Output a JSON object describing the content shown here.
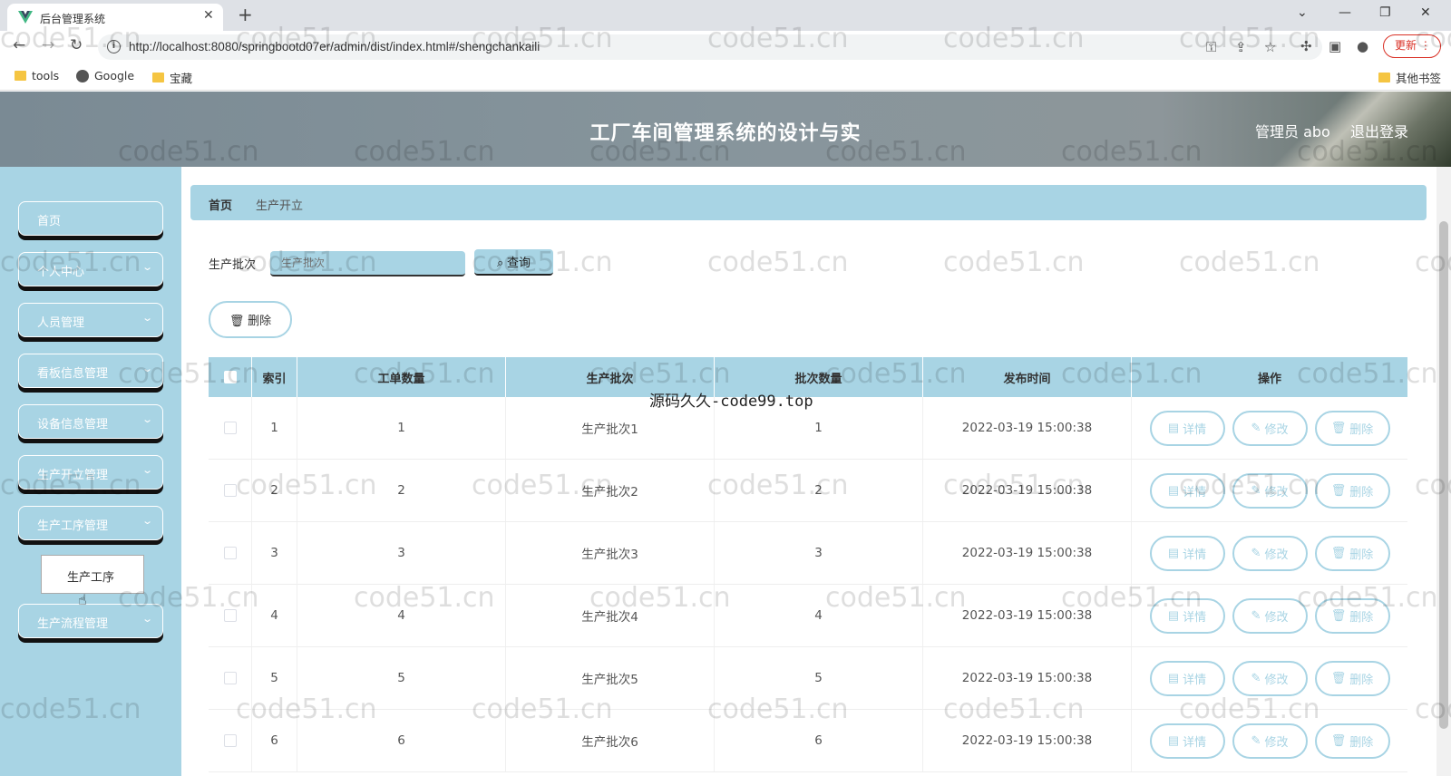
{
  "browser": {
    "tab_title": "后台管理系统",
    "url": "http://localhost:8080/springbootd07er/admin/dist/index.html#/shengchankaili",
    "update_label": "更新",
    "bookmarks": [
      "tools",
      "Google",
      "宝藏"
    ],
    "other_bookmarks": "其他书签"
  },
  "header": {
    "title": "工厂车间管理系统的设计与实",
    "user": "管理员 abo",
    "logout": "退出登录"
  },
  "sidebar": {
    "items": [
      {
        "label": "首页"
      },
      {
        "label": "个人中心"
      },
      {
        "label": "人员管理"
      },
      {
        "label": "看板信息管理"
      },
      {
        "label": "设备信息管理"
      },
      {
        "label": "生产开立管理"
      },
      {
        "label": "生产工序管理"
      },
      {
        "label": "生产流程管理"
      }
    ],
    "submenu_item": "生产工序"
  },
  "breadcrumb": {
    "home": "首页",
    "current": "生产开立"
  },
  "search": {
    "label": "生产批次",
    "placeholder": "生产批次",
    "button": "查询"
  },
  "delete_button": "删除",
  "table": {
    "headers": [
      "索引",
      "工单数量",
      "生产批次",
      "批次数量",
      "发布时间",
      "操作"
    ],
    "rows": [
      {
        "index": "1",
        "work_orders": "1",
        "batch": "生产批次1",
        "batch_qty": "1",
        "time": "2022-03-19 15:00:38"
      },
      {
        "index": "2",
        "work_orders": "2",
        "batch": "生产批次2",
        "batch_qty": "2",
        "time": "2022-03-19 15:00:38"
      },
      {
        "index": "3",
        "work_orders": "3",
        "batch": "生产批次3",
        "batch_qty": "3",
        "time": "2022-03-19 15:00:38"
      },
      {
        "index": "4",
        "work_orders": "4",
        "batch": "生产批次4",
        "batch_qty": "4",
        "time": "2022-03-19 15:00:38"
      },
      {
        "index": "5",
        "work_orders": "5",
        "batch": "生产批次5",
        "batch_qty": "5",
        "time": "2022-03-19 15:00:38"
      },
      {
        "index": "6",
        "work_orders": "6",
        "batch": "生产批次6",
        "batch_qty": "6",
        "time": "2022-03-19 15:00:38"
      }
    ],
    "actions": {
      "detail": "详情",
      "edit": "修改",
      "delete": "删除"
    }
  },
  "watermarks": {
    "repeat": "code51.cn",
    "center": "源码久久-code99.top"
  },
  "colors": {
    "accent": "#a8d4e4",
    "header_gray": "#87959c"
  }
}
